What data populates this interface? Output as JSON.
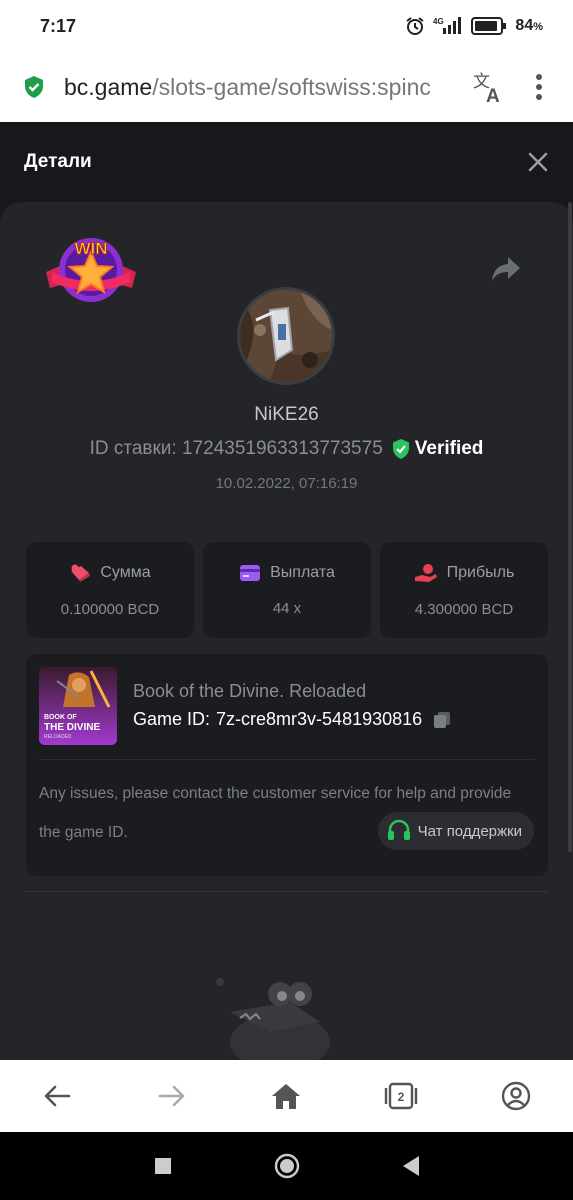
{
  "status_bar": {
    "time": "7:17",
    "network": "4G",
    "battery_percent": "84",
    "battery_unit": "%"
  },
  "url_bar": {
    "host": "bc.game",
    "path": "/slots-game/softswiss:spinc"
  },
  "page": {
    "title": "Детали"
  },
  "bet": {
    "username": "NiKE26",
    "id_label": "ID ставки:",
    "id_value": "1724351963313773575",
    "verified_label": "Verified",
    "date": "10.02.2022, 07:16:19",
    "win_badge_text": "WIN"
  },
  "stats": [
    {
      "icon": "bet-amount-icon",
      "label": "Сумма",
      "value": "0.100000 BCD",
      "color": "#ef4e6b"
    },
    {
      "icon": "payout-card-icon",
      "label": "Выплата",
      "value": "44 x",
      "color": "#9b5cf5"
    },
    {
      "icon": "profit-hand-icon",
      "label": "Прибыль",
      "value": "4.300000 BCD",
      "color": "#e8414f"
    }
  ],
  "game": {
    "title": "Book of the Divine. Reloaded",
    "id_label": "Game ID:",
    "id_value": "7z-cre8mr3v-5481930816",
    "thumb_line1": "BOOK OF",
    "thumb_line2": "THE DIVINE",
    "thumb_line3": "RELOADED",
    "issue_text": "Any issues, please contact the customer service for help and provide the game ID.",
    "support_label": "Чат поддержки"
  },
  "toolbar": {
    "tab_count": "2"
  },
  "colors": {
    "accent_green": "#29c45b",
    "panel_bg": "#232528",
    "page_bg": "#17181b"
  }
}
